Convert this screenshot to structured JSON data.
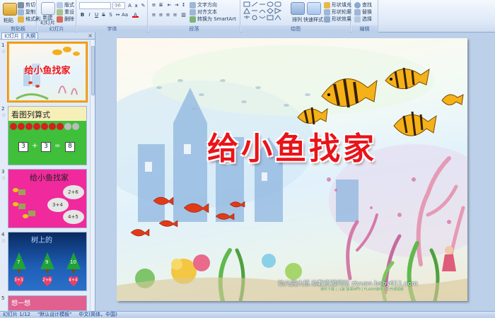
{
  "ribbon": {
    "clipboard": {
      "label": "剪贴板",
      "paste": "粘贴",
      "cut": "剪切",
      "copy": "复制",
      "format_painter": "格式刷"
    },
    "slides": {
      "label": "幻灯片",
      "new_slide": "新建",
      "new_slide_2": "幻灯片",
      "layout": "版式",
      "reset": "重设",
      "delete": "删除"
    },
    "font": {
      "label": "字体",
      "font_name": "",
      "font_size": "96"
    },
    "paragraph": {
      "label": "段落",
      "text_direction": "文字方向",
      "align_text": "对齐文本",
      "smartart": "转换为 SmartArt"
    },
    "drawing": {
      "label": "绘图",
      "arrange": "排列",
      "quick_styles": "快速样式",
      "shape_fill": "形状填充",
      "shape_outline": "形状轮廓",
      "shape_effects": "形状效果"
    },
    "editing": {
      "label": "编辑",
      "find": "查找",
      "replace": "替换",
      "select": "选择"
    }
  },
  "left_pane": {
    "tabs": [
      "幻灯片",
      "大纲"
    ],
    "close": "×",
    "slides": [
      {
        "num": "1",
        "title": "给小鱼找家"
      },
      {
        "num": "2",
        "title": "看图列算式",
        "eq_a": "3",
        "op": "+",
        "eq_b": "3",
        "eq_sign": "=",
        "eq_c": "8"
      },
      {
        "num": "3",
        "title": "给小鱼找家",
        "c1": "2+6",
        "c2": "3+4",
        "c3": "4+5"
      },
      {
        "num": "4",
        "title": "树上的",
        "t1": "7",
        "t2": "9",
        "t3": "10",
        "h1": "3+3",
        "h2": "2+6",
        "h3": "4+4"
      },
      {
        "num": "5",
        "title": "想一想"
      }
    ]
  },
  "slide": {
    "title": "给小鱼找家",
    "footer_brand": "幼儿园大班",
    "footer_site": "幼教资源网站 ziyuan.baby611.com",
    "footer_sub": "课件下载 | 儿歌 故事MP3 | FLASH课件 | 公开课视频"
  },
  "status": {
    "slide_info": "幻灯片 1/12",
    "theme": "\"默认设计模板\"",
    "language": "中文(简体，中国)"
  },
  "colors": {
    "title_red": "#e8141a",
    "ribbon_blue": "#15428b",
    "selection_orange": "#f5a623"
  }
}
